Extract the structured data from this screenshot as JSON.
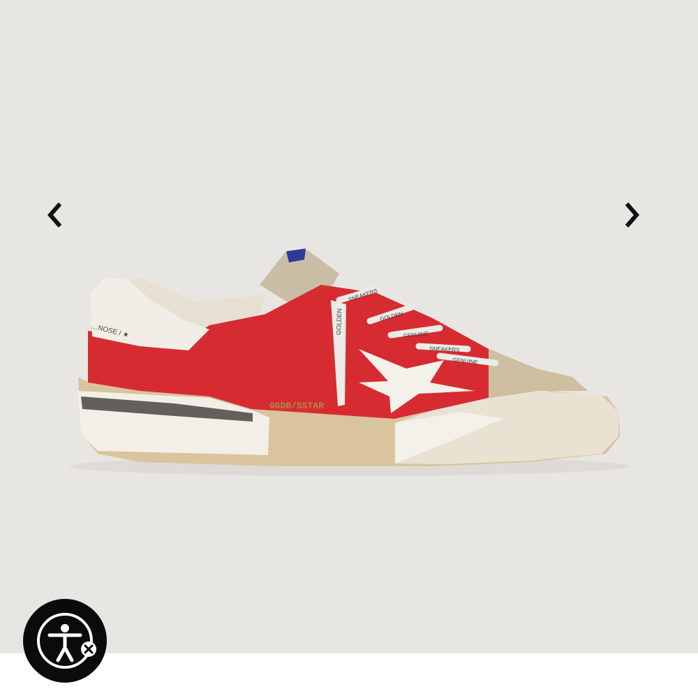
{
  "gallery": {
    "background_color": "#e8e6e3",
    "prev_icon": "chevron-left-icon",
    "next_icon": "chevron-right-icon"
  },
  "product": {
    "upper_color": "#d72b32",
    "heel_text": "…NOSE / ★",
    "side_text": "GGDB/SSTAR",
    "lace_tip_text": "GOLDEN",
    "lace_texts": [
      "SNEAKERS",
      "GOLDEN",
      "GENUINE",
      "SNEAKERS",
      "GENUINE"
    ]
  },
  "accessibility": {
    "icon": "accessibility-person-icon",
    "close_icon": "close-icon"
  }
}
